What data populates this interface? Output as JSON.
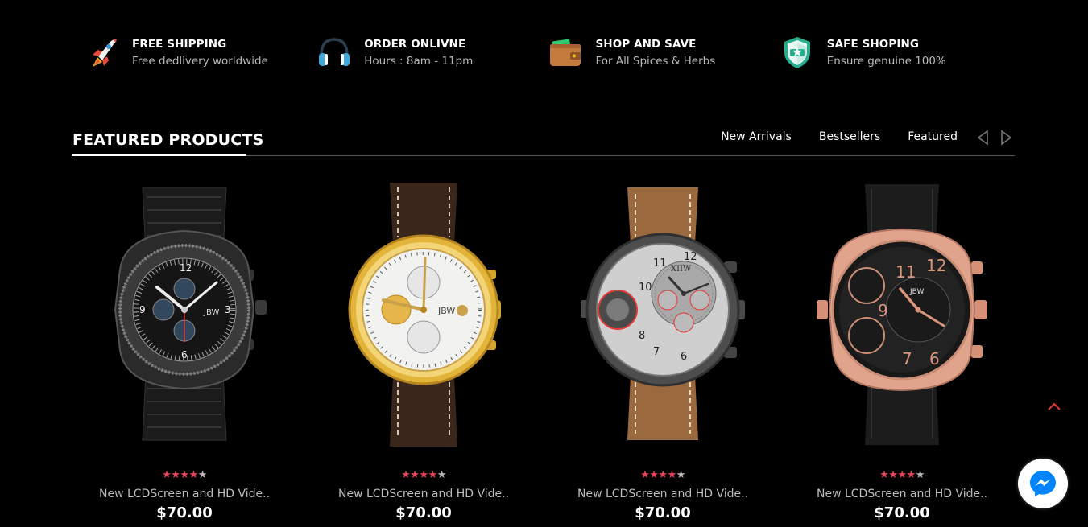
{
  "features": [
    {
      "icon": "rocket-icon",
      "title": "FREE SHIPPING",
      "subtitle": "Free dedlivery worldwide"
    },
    {
      "icon": "headphones-icon",
      "title": "ORDER ONLIVNE",
      "subtitle": "Hours : 8am - 11pm"
    },
    {
      "icon": "wallet-icon",
      "title": "SHOP AND SAVE",
      "subtitle": "For All Spices & Herbs"
    },
    {
      "icon": "shield-icon",
      "title": "SAFE SHOPING",
      "subtitle": "Ensure genuine 100%"
    }
  ],
  "section": {
    "title": "FEATURED PRODUCTS",
    "tabs": [
      "New Arrivals",
      "Bestsellers",
      "Featured"
    ]
  },
  "products": [
    {
      "name": "New LCDScreen and HD Vide..",
      "price": "$70.00",
      "rating": 4,
      "max_rating": 5,
      "image": "black-watch"
    },
    {
      "name": "New LCDScreen and HD Vide..",
      "price": "$70.00",
      "rating": 4,
      "max_rating": 5,
      "image": "gold-watch"
    },
    {
      "name": "New LCDScreen and HD Vide..",
      "price": "$70.00",
      "rating": 4,
      "max_rating": 5,
      "image": "gunmetal-watch"
    },
    {
      "name": "New LCDScreen and HD Vide..",
      "price": "$70.00",
      "rating": 4,
      "max_rating": 5,
      "image": "rose-gold-watch"
    }
  ],
  "colors": {
    "background": "#000000",
    "star_active": "#e8475b",
    "back_to_top": "#e53935",
    "messenger": "#0084ff"
  }
}
